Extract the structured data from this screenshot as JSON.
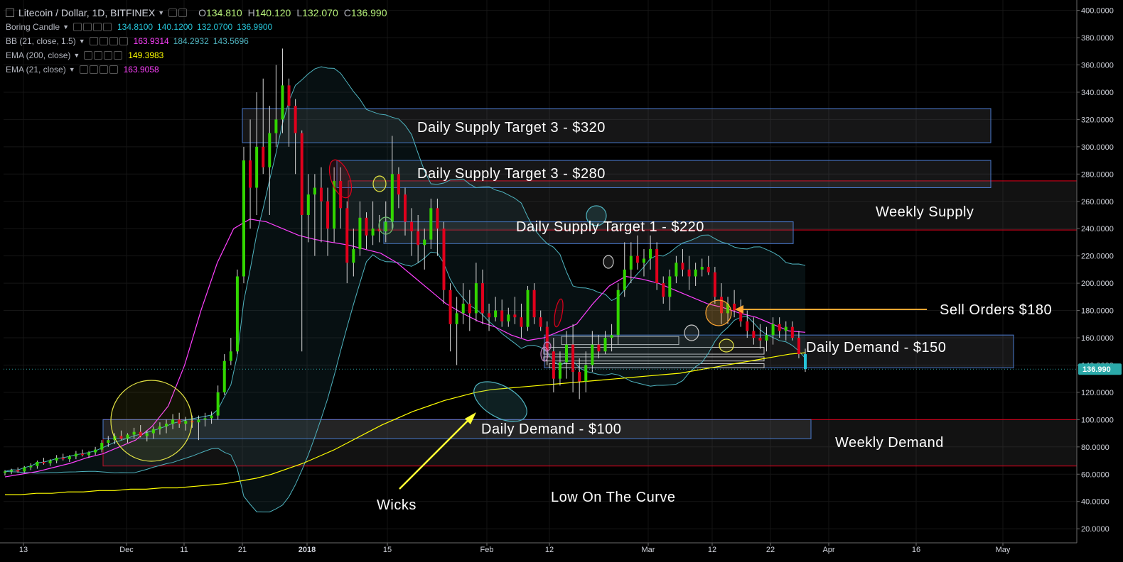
{
  "header": {
    "symbol_title": "Litecoin / Dollar, 1D, BITFINEX",
    "ohlc": [
      {
        "label": "O",
        "value": "134.810"
      },
      {
        "label": "H",
        "value": "140.120"
      },
      {
        "label": "L",
        "value": "132.070"
      },
      {
        "label": "C",
        "value": "136.990"
      }
    ]
  },
  "indicators": [
    {
      "name": "Boring Candle",
      "values": [
        "134.8100",
        "140.1200",
        "132.0700",
        "136.9900"
      ],
      "colors": [
        "#26c6da",
        "#26c6da",
        "#26c6da",
        "#26c6da"
      ]
    },
    {
      "name": "BB (21, close, 1.5)",
      "values": [
        "163.9314",
        "184.2932",
        "143.5696"
      ],
      "colors": [
        "#ff40ff",
        "#4fb3bf",
        "#4fb3bf"
      ]
    },
    {
      "name": "EMA (200, close)",
      "values": [
        "149.3983"
      ],
      "colors": [
        "#ffff00"
      ]
    },
    {
      "name": "EMA (21, close)",
      "values": [
        "163.9058"
      ],
      "colors": [
        "#ff40ff"
      ]
    }
  ],
  "colors": {
    "up": "#32d600",
    "down": "#e0001c",
    "boring": "#26c6da",
    "bb_line": "#4fb3bf",
    "ema21": "#ff40ff",
    "ema200": "#ffff00",
    "weekly_zone": "#e0001c",
    "daily_zone": "#4a7bd0",
    "arrow_yellow": "#ffff33",
    "arrow_orange": "#ffa733",
    "last_price_bg": "#2ba9a9"
  },
  "price_axis": {
    "ticks": [
      "20.0000",
      "40.0000",
      "60.0000",
      "80.0000",
      "100.0000",
      "120.0000",
      "140.0000",
      "160.0000",
      "180.0000",
      "200.0000",
      "220.0000",
      "240.0000",
      "260.0000",
      "280.0000",
      "300.0000",
      "320.0000",
      "340.0000",
      "360.0000",
      "380.0000",
      "400.0000"
    ],
    "last_price": "136.990"
  },
  "time_axis": {
    "labels": [
      {
        "text": "13",
        "bold": false
      },
      {
        "text": "Dec",
        "bold": false
      },
      {
        "text": "11",
        "bold": false
      },
      {
        "text": "21",
        "bold": false
      },
      {
        "text": "2018",
        "bold": true
      },
      {
        "text": "15",
        "bold": false
      },
      {
        "text": "Feb",
        "bold": false
      },
      {
        "text": "12",
        "bold": false
      },
      {
        "text": "Mar",
        "bold": false
      },
      {
        "text": "12",
        "bold": false
      },
      {
        "text": "22",
        "bold": false
      },
      {
        "text": "Apr",
        "bold": false
      },
      {
        "text": "16",
        "bold": false
      },
      {
        "text": "May",
        "bold": false
      }
    ]
  },
  "annotations": {
    "supply3_320": "Daily Supply Target 3 - $320",
    "supply3_280": "Daily Supply Target 3 - $280",
    "supply1_220": "Daily Supply Target 1 - $220",
    "weekly_supply": "Weekly Supply",
    "sell_orders": "Sell Orders $180",
    "demand_150": "Daily Demand - $150",
    "demand_100": "Daily Demand - $100",
    "weekly_demand": "Weekly Demand",
    "wicks": "Wicks",
    "low_on_curve": "Low On The Curve"
  },
  "chart_data": {
    "type": "candlestick",
    "ylim": [
      10,
      405
    ],
    "series": [
      {
        "name": "Litecoin / Dollar",
        "ohlc": [
          [
            61,
            63,
            59,
            62
          ],
          [
            62,
            64,
            60,
            63
          ],
          [
            63,
            65,
            61,
            62
          ],
          [
            62,
            66,
            61,
            65
          ],
          [
            65,
            68,
            63,
            66
          ],
          [
            66,
            70,
            64,
            69
          ],
          [
            69,
            72,
            67,
            68
          ],
          [
            68,
            71,
            66,
            70
          ],
          [
            70,
            74,
            68,
            72
          ],
          [
            72,
            75,
            70,
            71
          ],
          [
            71,
            74,
            69,
            73
          ],
          [
            73,
            77,
            71,
            75
          ],
          [
            75,
            78,
            73,
            74
          ],
          [
            74,
            77,
            72,
            76
          ],
          [
            76,
            80,
            74,
            78
          ],
          [
            78,
            85,
            76,
            83
          ],
          [
            83,
            88,
            80,
            85
          ],
          [
            85,
            90,
            82,
            88
          ],
          [
            88,
            92,
            85,
            86
          ],
          [
            86,
            90,
            83,
            89
          ],
          [
            89,
            94,
            86,
            91
          ],
          [
            91,
            96,
            87,
            88
          ],
          [
            88,
            92,
            84,
            90
          ],
          [
            90,
            95,
            86,
            93
          ],
          [
            93,
            98,
            89,
            95
          ],
          [
            95,
            100,
            90,
            97
          ],
          [
            97,
            104,
            93,
            100
          ],
          [
            100,
            105,
            94,
            97
          ],
          [
            97,
            102,
            92,
            99
          ],
          [
            99,
            103,
            94,
            98
          ],
          [
            98,
            103,
            85,
            100
          ],
          [
            100,
            105,
            95,
            101
          ],
          [
            101,
            106,
            97,
            103
          ],
          [
            103,
            125,
            100,
            120
          ],
          [
            120,
            148,
            118,
            143
          ],
          [
            143,
            160,
            140,
            150
          ],
          [
            150,
            210,
            148,
            205
          ],
          [
            205,
            300,
            200,
            290
          ],
          [
            290,
            320,
            240,
            270
          ],
          [
            270,
            340,
            250,
            300
          ],
          [
            300,
            350,
            280,
            285
          ],
          [
            285,
            330,
            250,
            310
          ],
          [
            310,
            360,
            300,
            320
          ],
          [
            320,
            372,
            310,
            345
          ],
          [
            345,
            350,
            300,
            330
          ],
          [
            330,
            335,
            280,
            310
          ],
          [
            310,
            312,
            150,
            250
          ],
          [
            250,
            280,
            230,
            265
          ],
          [
            265,
            280,
            220,
            270
          ],
          [
            270,
            285,
            230,
            260
          ],
          [
            260,
            270,
            220,
            240
          ],
          [
            240,
            285,
            230,
            275
          ],
          [
            275,
            285,
            240,
            255
          ],
          [
            255,
            260,
            200,
            215
          ],
          [
            215,
            240,
            205,
            225
          ],
          [
            225,
            260,
            220,
            248
          ],
          [
            248,
            252,
            225,
            235
          ],
          [
            235,
            260,
            228,
            240
          ],
          [
            240,
            250,
            230,
            238
          ],
          [
            238,
            260,
            230,
            245
          ],
          [
            245,
            308,
            240,
            280
          ],
          [
            280,
            285,
            255,
            265
          ],
          [
            265,
            270,
            235,
            245
          ],
          [
            245,
            255,
            220,
            238
          ],
          [
            238,
            250,
            215,
            228
          ],
          [
            228,
            240,
            210,
            232
          ],
          [
            232,
            262,
            225,
            255
          ],
          [
            255,
            262,
            220,
            240
          ],
          [
            240,
            245,
            185,
            195
          ],
          [
            195,
            200,
            150,
            170
          ],
          [
            170,
            190,
            140,
            178
          ],
          [
            178,
            200,
            170,
            185
          ],
          [
            185,
            195,
            165,
            178
          ],
          [
            178,
            215,
            172,
            200
          ],
          [
            200,
            210,
            170,
            178
          ],
          [
            178,
            185,
            165,
            175
          ],
          [
            175,
            190,
            172,
            180
          ],
          [
            180,
            188,
            168,
            172
          ],
          [
            172,
            182,
            168,
            177
          ],
          [
            177,
            190,
            170,
            175
          ],
          [
            175,
            185,
            160,
            168
          ],
          [
            168,
            198,
            165,
            195
          ],
          [
            195,
            200,
            170,
            175
          ],
          [
            175,
            180,
            165,
            168
          ],
          [
            168,
            172,
            140,
            150
          ],
          [
            150,
            160,
            120,
            130
          ],
          [
            130,
            150,
            125,
            142
          ],
          [
            142,
            165,
            130,
            155
          ],
          [
            155,
            170,
            120,
            135
          ],
          [
            135,
            145,
            115,
            128
          ],
          [
            128,
            150,
            120,
            140
          ],
          [
            140,
            165,
            135,
            155
          ],
          [
            155,
            162,
            145,
            150
          ],
          [
            150,
            165,
            148,
            160
          ],
          [
            160,
            170,
            150,
            162
          ],
          [
            162,
            200,
            155,
            195
          ],
          [
            195,
            230,
            190,
            210
          ],
          [
            210,
            230,
            200,
            220
          ],
          [
            220,
            235,
            210,
            215
          ],
          [
            215,
            225,
            205,
            218
          ],
          [
            218,
            235,
            210,
            225
          ],
          [
            225,
            230,
            195,
            200
          ],
          [
            200,
            205,
            185,
            190
          ],
          [
            190,
            210,
            180,
            205
          ],
          [
            205,
            220,
            200,
            215
          ],
          [
            215,
            225,
            205,
            210
          ],
          [
            210,
            220,
            195,
            205
          ],
          [
            205,
            215,
            198,
            210
          ],
          [
            210,
            218,
            205,
            212
          ],
          [
            212,
            220,
            206,
            208
          ],
          [
            208,
            212,
            185,
            190
          ],
          [
            190,
            200,
            170,
            178
          ],
          [
            178,
            190,
            170,
            185
          ],
          [
            185,
            195,
            175,
            180
          ],
          [
            180,
            188,
            168,
            172
          ],
          [
            172,
            180,
            160,
            165
          ],
          [
            165,
            175,
            155,
            160
          ],
          [
            160,
            170,
            152,
            158
          ],
          [
            158,
            168,
            150,
            162
          ],
          [
            162,
            175,
            155,
            170
          ],
          [
            170,
            175,
            160,
            165
          ],
          [
            165,
            172,
            158,
            168
          ],
          [
            168,
            172,
            158,
            160
          ],
          [
            160,
            165,
            145,
            148
          ],
          [
            148,
            152,
            135,
            137
          ]
        ]
      },
      {
        "name": "EMA (200, close)",
        "values": [
          45,
          45,
          46,
          46,
          47,
          47,
          48,
          48,
          49,
          49,
          50,
          50,
          51,
          52,
          53,
          55,
          57,
          60,
          64,
          68,
          73,
          78,
          84,
          90,
          96,
          101,
          106,
          110,
          114,
          117,
          120,
          122,
          123,
          124,
          125,
          126,
          127,
          128,
          129,
          130,
          131,
          132,
          133,
          134,
          136,
          138,
          140,
          142,
          144,
          146,
          148,
          149
        ]
      },
      {
        "name": "EMA (21, close)",
        "values": [
          58,
          60,
          62,
          65,
          68,
          72,
          75,
          80,
          85,
          95,
          110,
          140,
          180,
          215,
          240,
          247,
          245,
          240,
          235,
          232,
          230,
          228,
          225,
          222,
          215,
          205,
          195,
          185,
          178,
          172,
          168,
          162,
          158,
          160,
          165,
          170,
          185,
          198,
          205,
          203,
          200,
          195,
          190,
          185,
          182,
          178,
          175,
          170,
          165,
          164
        ]
      }
    ]
  }
}
